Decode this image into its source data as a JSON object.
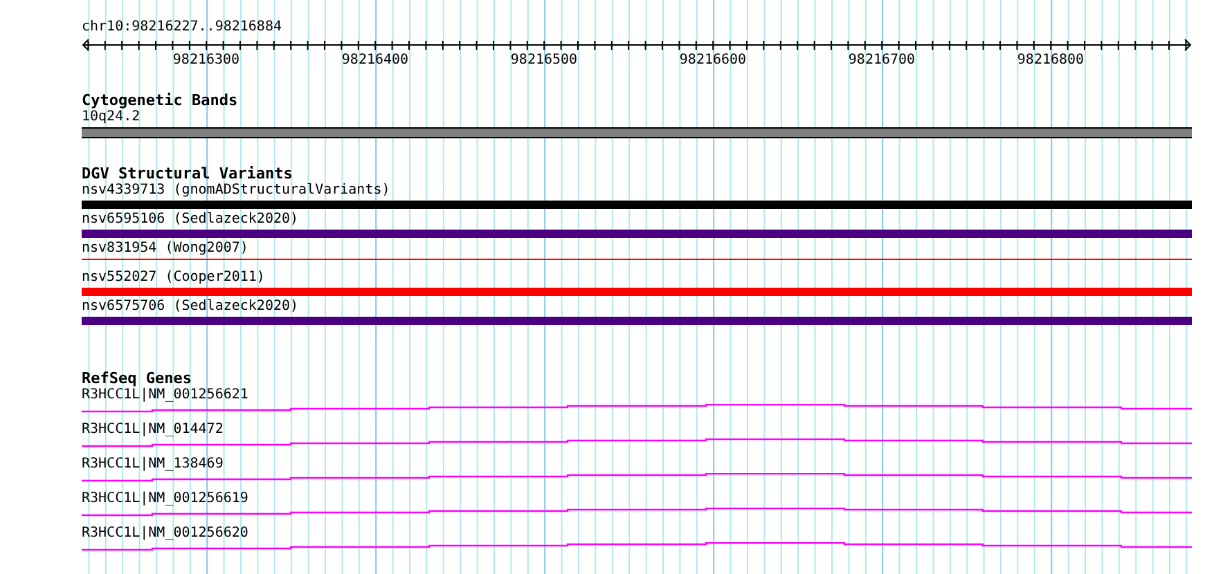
{
  "ruler": {
    "region": "chr10:98216227..98216884",
    "tick_labels": [
      "98216300",
      "98216400",
      "98216500",
      "98216600",
      "98216700",
      "98216800"
    ]
  },
  "cytoband_track": {
    "title": "Cytogenetic Bands",
    "features": [
      {
        "label": "10q24.2"
      }
    ]
  },
  "dgv_track": {
    "title": "DGV Structural Variants",
    "features": [
      {
        "label": "nsv4339713 (gnomADStructuralVariants)",
        "kind": "bar",
        "color": "#000000"
      },
      {
        "label": "nsv6595106 (Sedlazeck2020)",
        "kind": "bar",
        "color": "#4b0082"
      },
      {
        "label": "nsv831954 (Wong2007)",
        "kind": "line",
        "color": "#ff0000"
      },
      {
        "label": "nsv552027 (Cooper2011)",
        "kind": "bar",
        "color": "#ff0000"
      },
      {
        "label": "nsv6575706 (Sedlazeck2020)",
        "kind": "bar",
        "color": "#4b0082"
      }
    ]
  },
  "refseq_track": {
    "title": "RefSeq Genes",
    "features": [
      {
        "label": "R3HCC1L|NM_001256621"
      },
      {
        "label": "R3HCC1L|NM_014472"
      },
      {
        "label": "R3HCC1L|NM_138469"
      },
      {
        "label": "R3HCC1L|NM_001256619"
      },
      {
        "label": "R3HCC1L|NM_001256620"
      }
    ]
  }
}
